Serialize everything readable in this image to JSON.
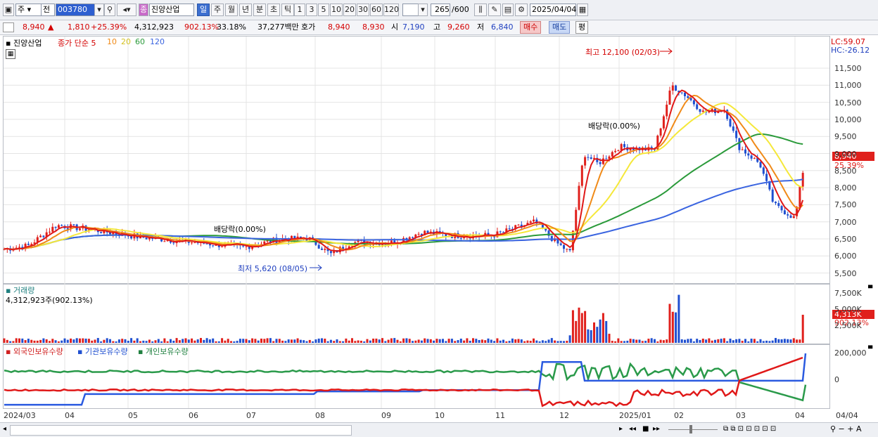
{
  "toolbar": {
    "market": "주",
    "scope": "전",
    "code": "003780",
    "stock_name": "진양산업",
    "stock_badge": "종",
    "periods": [
      "일",
      "주",
      "월",
      "년",
      "분",
      "초",
      "틱"
    ],
    "active_period": "일",
    "intervals": [
      "1",
      "3",
      "5",
      "10",
      "20",
      "30",
      "60",
      "120"
    ],
    "count": "265",
    "count_total": "/600",
    "date": "2025/04/04"
  },
  "quote": {
    "price": "8,940",
    "arrow": "▲",
    "change": "1,810",
    "change_pct": "+25.39%",
    "volume": "4,312,923",
    "volume_pct": "902.13%",
    "turnover": "33.18%",
    "amount": "37,277백만",
    "ask_label": "호가",
    "ask": "8,940",
    "bid": "8,930",
    "open_label": "시",
    "open": "7,190",
    "high_label": "고",
    "high": "9,260",
    "low_label": "저",
    "low": "6,840",
    "buy_btn": "매수",
    "sell_btn": "매도",
    "eval_btn": "평"
  },
  "price_panel": {
    "legend_name": "진양산업",
    "legend_ma": "종가 단순 5",
    "ma10": "10",
    "ma20": "20",
    "ma60": "60",
    "ma120": "120",
    "lc": "LC:59.07",
    "hc": "HC:-26.12",
    "high_note": "최고 12,100 (02/03)",
    "low_note": "최저 5,620 (08/05)",
    "div1": "배당락(0.00%)",
    "div2": "배당락(0.00%)",
    "last_price_tag": "8,940",
    "last_pct_tag": "25.39%",
    "y_ticks": [
      "11,500",
      "11,000",
      "10,500",
      "10,000",
      "9,500",
      "9,000",
      "8,500",
      "8,000",
      "7,500",
      "7,000",
      "6,500",
      "6,000",
      "5,500"
    ]
  },
  "volume_panel": {
    "title": "거래량",
    "value": "4,312,923주(902.13%)",
    "y_ticks": [
      "7,500K",
      "5,000K",
      "2,500K"
    ],
    "tag": "4,313K",
    "tag_pct": "902.13%"
  },
  "holdings_panel": {
    "l1": "외국인보유수량",
    "l2": "기관보유수량",
    "l3": "개인보유수량",
    "y_ticks": [
      "200,000",
      "0"
    ]
  },
  "x_axis": [
    "2024/03",
    "04",
    "05",
    "06",
    "07",
    "08",
    "09",
    "10",
    "11",
    "12",
    "2025/01",
    "02",
    "03",
    "04"
  ],
  "x_right": "04/04",
  "colors": {
    "up": "#e0201c",
    "down": "#1f4fd0",
    "ma5": "#e01818",
    "ma10": "#f08a18",
    "ma20": "#f5e83a",
    "ma60": "#2a9a3a",
    "ma120": "#3a64e0"
  }
}
